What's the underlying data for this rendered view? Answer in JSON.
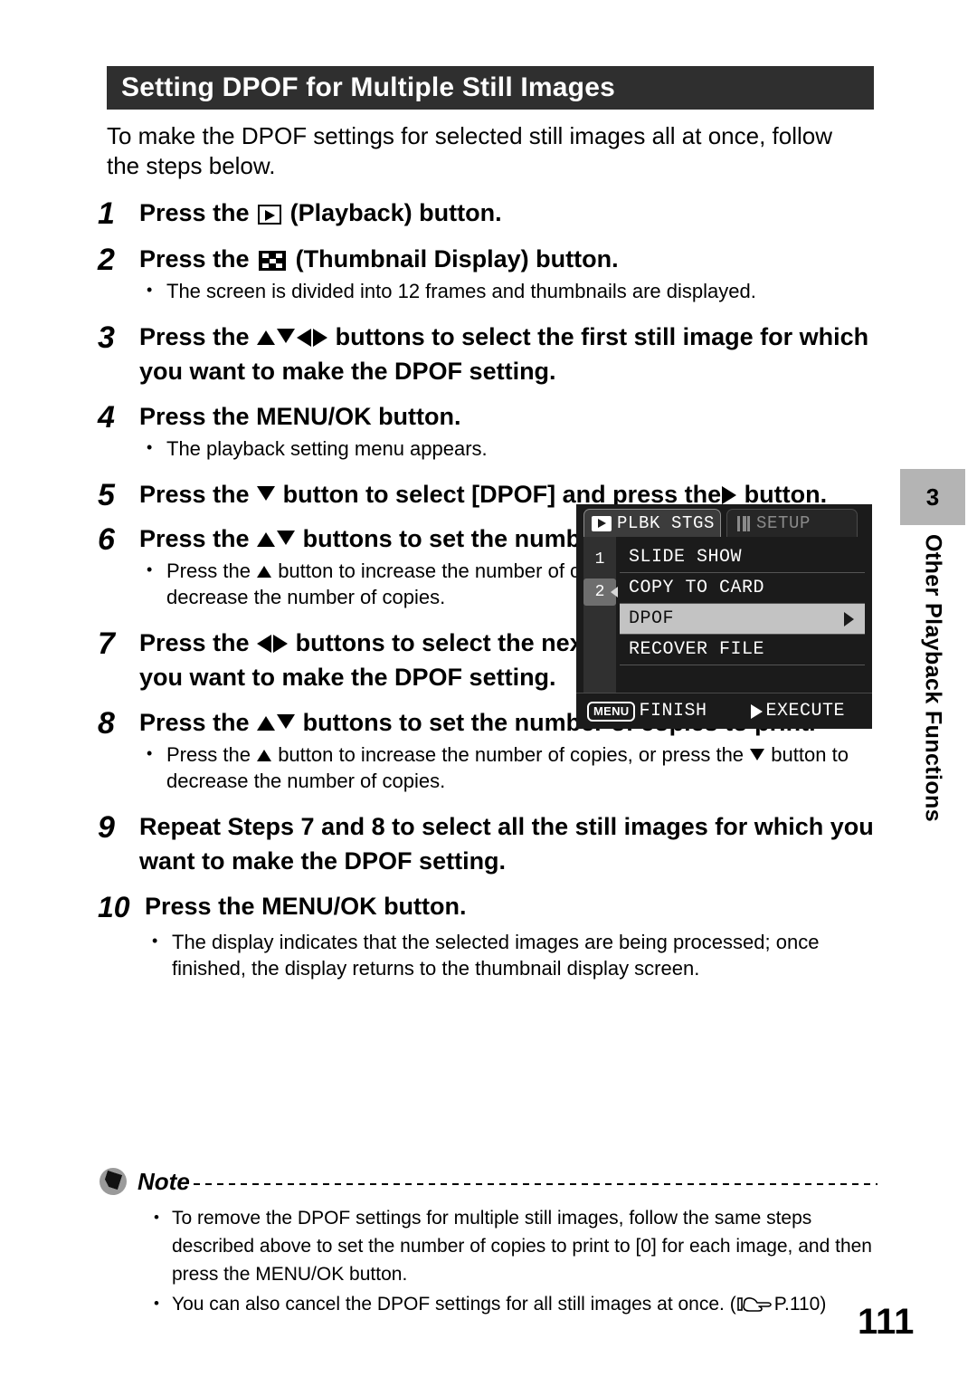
{
  "header": {
    "title": "Setting DPOF for Multiple Still Images"
  },
  "intro": "To make the DPOF settings for selected still images all at once, follow the steps below.",
  "steps": [
    {
      "num": "1",
      "text_before": "Press the",
      "icon": "playback-icon",
      "text_after": "(Playback) button.",
      "bullets": []
    },
    {
      "num": "2",
      "text_before": "Press the",
      "icon": "thumbnail-display-icon",
      "text_after": "(Thumbnail Display) button.",
      "bullets": [
        "The screen is divided into 12 frames and thumbnails are displayed."
      ]
    },
    {
      "num": "3",
      "text_before": "Press the",
      "icon": "up-down-left-right-arrows",
      "text_after": "buttons to select the first still image for which you want to make the DPOF setting.",
      "bullets": []
    },
    {
      "num": "4",
      "text_before": "Press the MENU/OK button.",
      "icon": "",
      "text_after": "",
      "bullets": [
        "The playback setting menu appears."
      ]
    },
    {
      "num": "5",
      "text_before": "Press the",
      "icon": "down-arrow",
      "text_mid": "button to select [DPOF] and press the",
      "icon2": "right-arrow",
      "text_after": "button.",
      "bullets": []
    },
    {
      "num": "6",
      "text_before": "Press the",
      "icon": "up-down-arrows",
      "text_after": "buttons to set the number of copies to print.",
      "bullets": [
        "Press the ▲ button to increase the number of copies, or press the ▼ button to decrease the number of copies."
      ]
    },
    {
      "num": "7",
      "text_before": "Press the",
      "icon": "left-right-arrows",
      "text_after": "buttons to select the next still image for which you want to make the DPOF setting.",
      "bullets": []
    },
    {
      "num": "8",
      "text_before": "Press the",
      "icon": "up-down-arrows",
      "text_after": "buttons to set the number of copies to print.",
      "bullets": [
        "Press the ▲ button to increase the number of copies, or press the ▼ button to decrease the number of copies."
      ]
    },
    {
      "num": "9",
      "text_before": "Repeat Steps 7 and 8 to select all the still images for which you want to make the DPOF setting.",
      "icon": "",
      "text_after": "",
      "bullets": []
    },
    {
      "num": "10",
      "text_before": "Press the MENU/OK button.",
      "icon": "",
      "text_after": "",
      "bullets": [
        "The display indicates that the selected images are being processed; once finished, the display returns to the thumbnail display screen."
      ]
    }
  ],
  "step_text": {
    "s1_before": "Press the",
    "s1_after": "(Playback) button.",
    "s2_before": "Press the",
    "s2_after": "(Thumbnail Display) button.",
    "s2_bullet": "The screen is divided into 12 frames and thumbnails are displayed.",
    "s3_before": "Press the",
    "s3_after": "buttons to select the first still image for which you want to make the DPOF setting.",
    "s4_head": "Press the MENU/OK button.",
    "s4_bullet": "The playback setting menu appears.",
    "s5_before": "Press the",
    "s5_mid": "button to select [DPOF] and press the",
    "s5_after": "button.",
    "s6_before": "Press the",
    "s6_after": "buttons to set the number of copies to print.",
    "s6_bullet_a": "Press the",
    "s6_bullet_b": "button to increase the number of copies, or press the",
    "s6_bullet_c": "button to decrease the number of copies.",
    "s7_before": "Press the",
    "s7_after": "buttons to select the next still image for which you want to make the DPOF setting.",
    "s8_before": "Press the",
    "s8_after": "buttons to set the number of copies to print.",
    "s8_bullet_a": "Press the",
    "s8_bullet_b": "button to increase the number of copies, or press the",
    "s8_bullet_c": "button to decrease the number of copies.",
    "s9_head": "Repeat Steps 7 and 8 to select all the still images for which you want to make the DPOF setting.",
    "s10_head": "Press the MENU/OK button.",
    "s10_bullet": "The display indicates that the selected images are being processed; once finished, the display returns to the thumbnail display screen."
  },
  "lcd_screen": {
    "tabs": [
      {
        "label": "PLBK STGS",
        "icon": "playback-icon",
        "active": true
      },
      {
        "label": "SETUP",
        "icon": "tools-icon",
        "active": false
      }
    ],
    "page_markers": [
      "1",
      "2"
    ],
    "menu_items": [
      {
        "label": "SLIDE SHOW",
        "selected": false,
        "has_arrow": false
      },
      {
        "label": "COPY TO CARD",
        "selected": false,
        "has_arrow": false
      },
      {
        "label": "DPOF",
        "selected": true,
        "has_arrow": true
      },
      {
        "label": "RECOVER FILE",
        "selected": false,
        "has_arrow": false
      }
    ],
    "footer": {
      "menu_chip": "MENU",
      "finish_label": "FINISH",
      "execute_label": "EXECUTE"
    },
    "colors": {
      "background": "#1b1b1b",
      "selected_row": "#c3c3c3",
      "active_tab": "#3c3c3c"
    }
  },
  "side_tab": {
    "chapter_number": "3",
    "chapter_label": "Other Playback Functions",
    "color": "#b4b4b4"
  },
  "note": {
    "title": "Note",
    "bullets": [
      "To remove the DPOF settings for multiple still images, follow the same steps described above to set the number of copies to print to [0] for each image, and then press the MENU/OK button.",
      "You can also cancel the DPOF settings for all still images at once. ("
    ],
    "reference_page": "P.110",
    "reference_close": ")"
  },
  "page_number": "111"
}
